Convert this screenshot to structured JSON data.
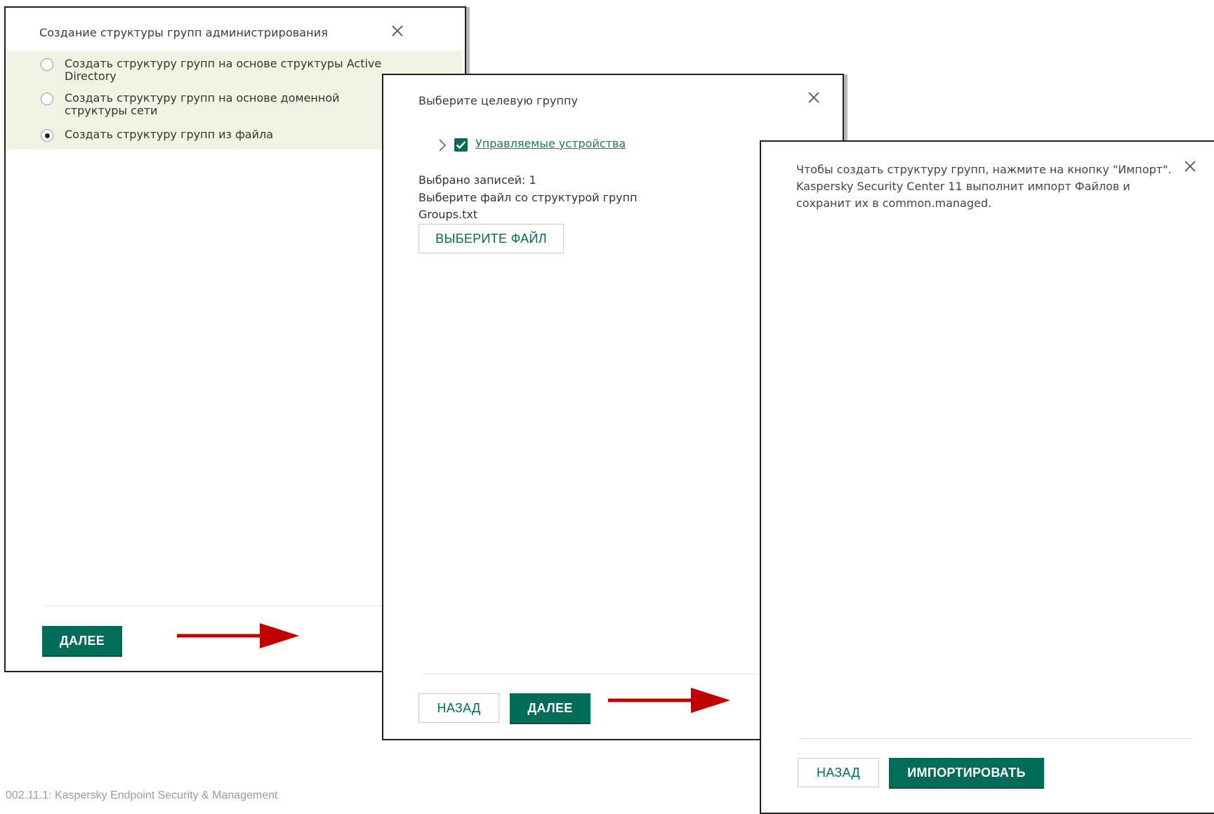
{
  "dialog1": {
    "title": "Создание структуры групп администрирования",
    "options": [
      {
        "label": "Создать структуру групп на основе структуры Active Directory",
        "selected": false
      },
      {
        "label": "Создать структуру групп на основе доменной структуры сети",
        "selected": false
      },
      {
        "label": "Создать структуру групп из файла",
        "selected": true
      }
    ],
    "next_label": "ДАЛЕЕ"
  },
  "dialog2": {
    "title": "Выберите целевую группу",
    "tree_item": {
      "label": "Управляемые устройства",
      "checked": true
    },
    "selected_count_text": "Выбрано записей: 1",
    "choose_file_prompt": "Выберите файл со структурой групп",
    "file_name": "Groups.txt",
    "choose_file_label": "ВЫБЕРИТЕ ФАЙЛ",
    "back_label": "НАЗАД",
    "next_label": "ДАЛЕЕ"
  },
  "dialog3": {
    "message": "Чтобы создать структуру групп, нажмите на кнопку \"Импорт\". Kaspersky Security Center 11 выполнит импорт Файлов и сохранит их в common.managed.",
    "back_label": "НАЗАД",
    "import_label": "ИМПОРТИРОВАТЬ"
  },
  "footnote": "002.11.1: Kaspersky Endpoint Security & Management",
  "colors": {
    "accent": "#006d5b",
    "link": "#137d6a",
    "option_highlight": "#f0f3e2",
    "arrow": "#c00000"
  },
  "icons": [
    "close-icon",
    "chevron-right-icon",
    "checkbox-checked-icon",
    "arrow-right-icon"
  ]
}
